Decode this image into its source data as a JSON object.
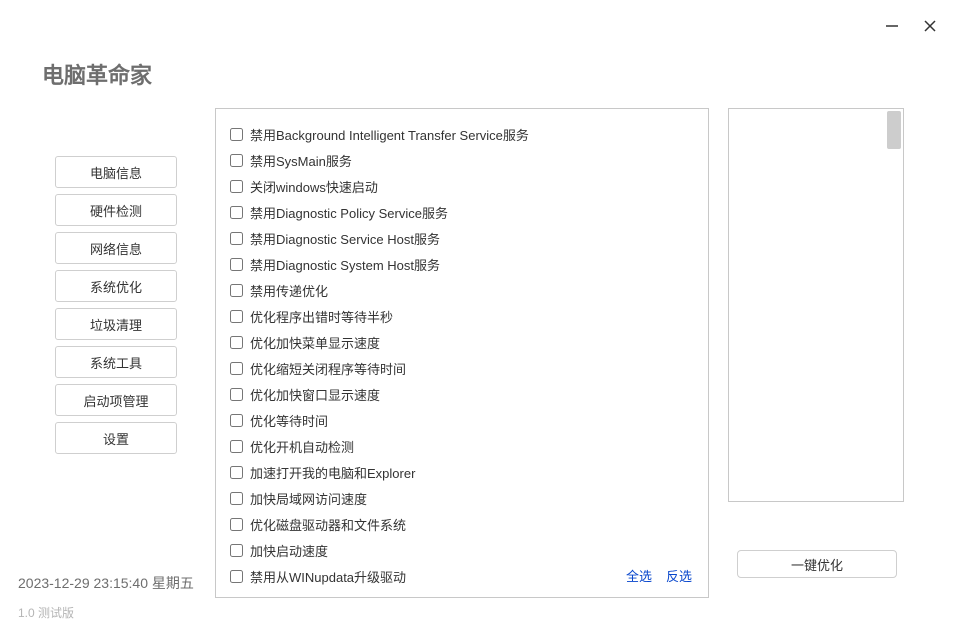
{
  "app": {
    "title": "电脑革命家"
  },
  "sidebar": {
    "items": [
      {
        "label": "电脑信息"
      },
      {
        "label": "硬件检测"
      },
      {
        "label": "网络信息"
      },
      {
        "label": "系统优化"
      },
      {
        "label": "垃圾清理"
      },
      {
        "label": "系统工具"
      },
      {
        "label": "启动项管理"
      },
      {
        "label": "设置"
      }
    ]
  },
  "optimize": {
    "items": [
      {
        "label": "禁用Background Intelligent Transfer Service服务"
      },
      {
        "label": "禁用SysMain服务"
      },
      {
        "label": "关闭windows快速启动"
      },
      {
        "label": "禁用Diagnostic Policy Service服务"
      },
      {
        "label": "禁用Diagnostic Service Host服务"
      },
      {
        "label": "禁用Diagnostic System Host服务"
      },
      {
        "label": "禁用传递优化"
      },
      {
        "label": "优化程序出错时等待半秒"
      },
      {
        "label": "优化加快菜单显示速度"
      },
      {
        "label": "优化缩短关闭程序等待时间"
      },
      {
        "label": "优化加快窗口显示速度"
      },
      {
        "label": "优化等待时间"
      },
      {
        "label": "优化开机自动检测"
      },
      {
        "label": "加速打开我的电脑和Explorer"
      },
      {
        "label": "加快局域网访问速度"
      },
      {
        "label": "优化磁盘驱动器和文件系统"
      },
      {
        "label": "加快启动速度"
      },
      {
        "label": "禁用从WINupdata升级驱动"
      }
    ],
    "select_all": "全选",
    "select_invert": "反选",
    "run_label": "一键优化"
  },
  "footer": {
    "datetime": "2023-12-29 23:15:40  星期五",
    "version": "1.0  测试版"
  }
}
